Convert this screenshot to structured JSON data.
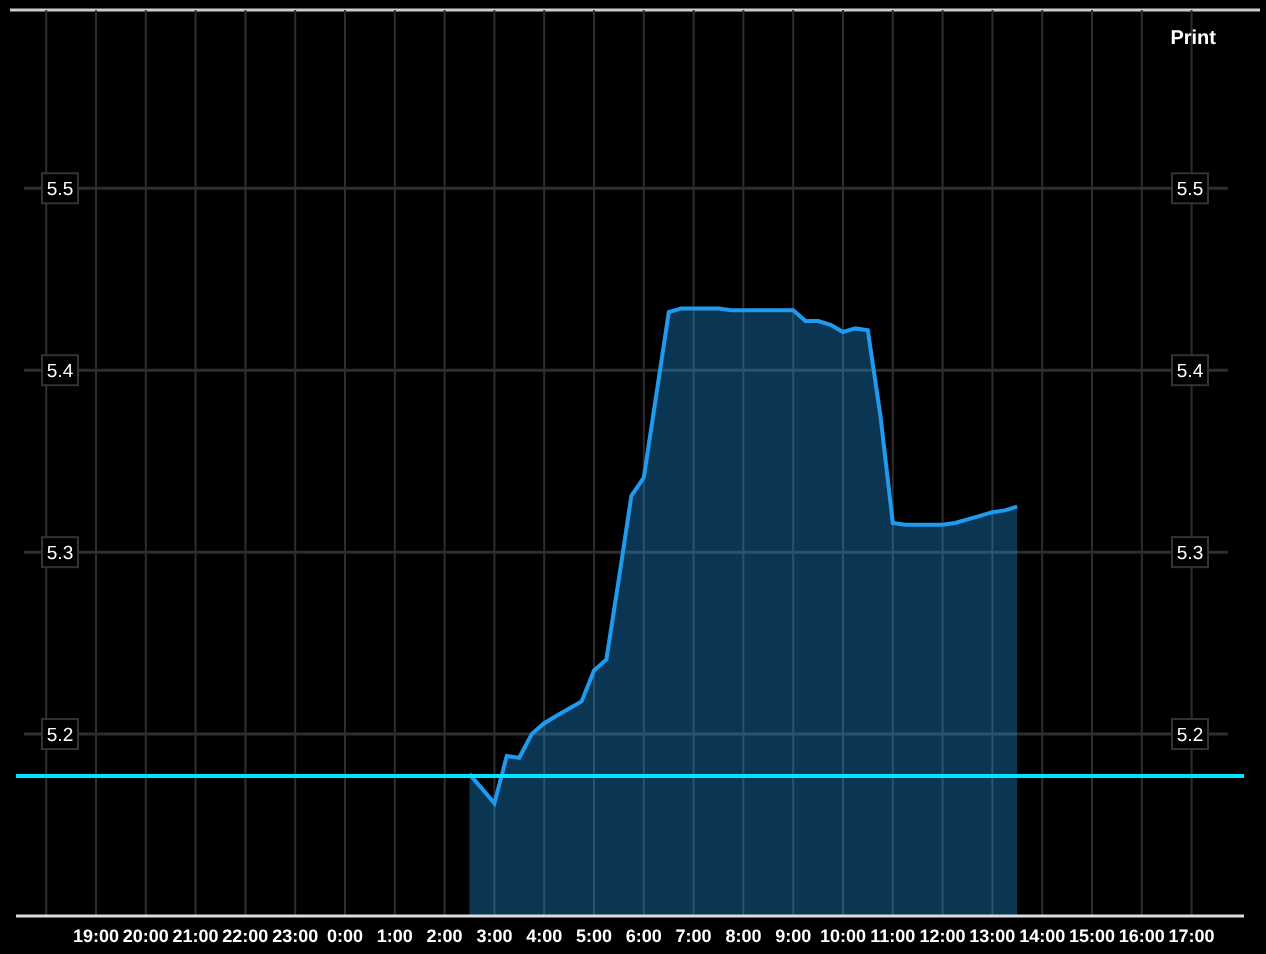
{
  "print_button": "Print",
  "right_axis_labels": [
    "5.5",
    "5.4",
    "5.3",
    "5.2"
  ],
  "chart_data": {
    "type": "area",
    "ylim": [
      5.1,
      5.598
    ],
    "categories": [
      null,
      null,
      null,
      null,
      "19:00",
      null,
      null,
      null,
      "20:00",
      null,
      null,
      null,
      "21:00",
      null,
      null,
      null,
      "22:00",
      null,
      null,
      null,
      "23:00",
      null,
      null,
      null,
      "0:00",
      null,
      null,
      null,
      "1:00",
      null,
      null,
      null,
      "2:00",
      null,
      null,
      null,
      "3:00",
      null,
      null,
      null,
      "4:00",
      null,
      null,
      null,
      "5:00",
      null,
      null,
      null,
      "6:00",
      null,
      null,
      null,
      "7:00",
      null,
      null,
      null,
      "8:00",
      null,
      null,
      null,
      "9:00",
      null,
      null,
      null,
      "10:00",
      null,
      null,
      null,
      "11:00",
      null,
      null,
      null,
      "12:00",
      null,
      null,
      null,
      "13:00",
      null,
      null,
      null,
      "14:00",
      null,
      null,
      null,
      "15:00",
      null,
      null,
      null,
      "16:00",
      null,
      null,
      null,
      "17:00"
    ],
    "yticks": [
      5.2,
      5.3,
      5.4,
      5.5
    ],
    "grid": true,
    "series": [
      {
        "color": "#1e9bf0",
        "values": [
          null,
          null,
          null,
          null,
          null,
          null,
          null,
          null,
          null,
          null,
          null,
          null,
          null,
          null,
          null,
          null,
          null,
          null,
          null,
          null,
          null,
          null,
          null,
          null,
          null,
          null,
          null,
          null,
          null,
          null,
          null,
          null,
          null,
          null,
          5.178,
          5.17,
          5.162,
          5.188,
          5.187,
          5.2,
          5.206,
          5.21,
          5.214,
          5.218,
          5.235,
          5.241,
          5.285,
          5.331,
          5.341,
          5.386,
          5.432,
          5.434,
          5.434,
          5.434,
          5.434,
          5.433,
          5.433,
          5.433,
          5.433,
          5.433,
          5.433,
          5.427,
          5.427,
          5.425,
          5.421,
          5.423,
          5.422,
          5.375,
          5.316,
          5.315,
          5.315,
          5.315,
          5.315,
          5.316,
          5.318,
          5.32,
          5.322,
          5.323,
          5.325,
          null,
          null,
          null,
          null,
          null,
          null,
          null,
          null,
          null,
          null,
          null,
          null,
          null,
          null
        ]
      }
    ],
    "ref_lines": [
      {
        "axis": "y",
        "value": 5.177,
        "color": "#00e5ff"
      }
    ]
  }
}
